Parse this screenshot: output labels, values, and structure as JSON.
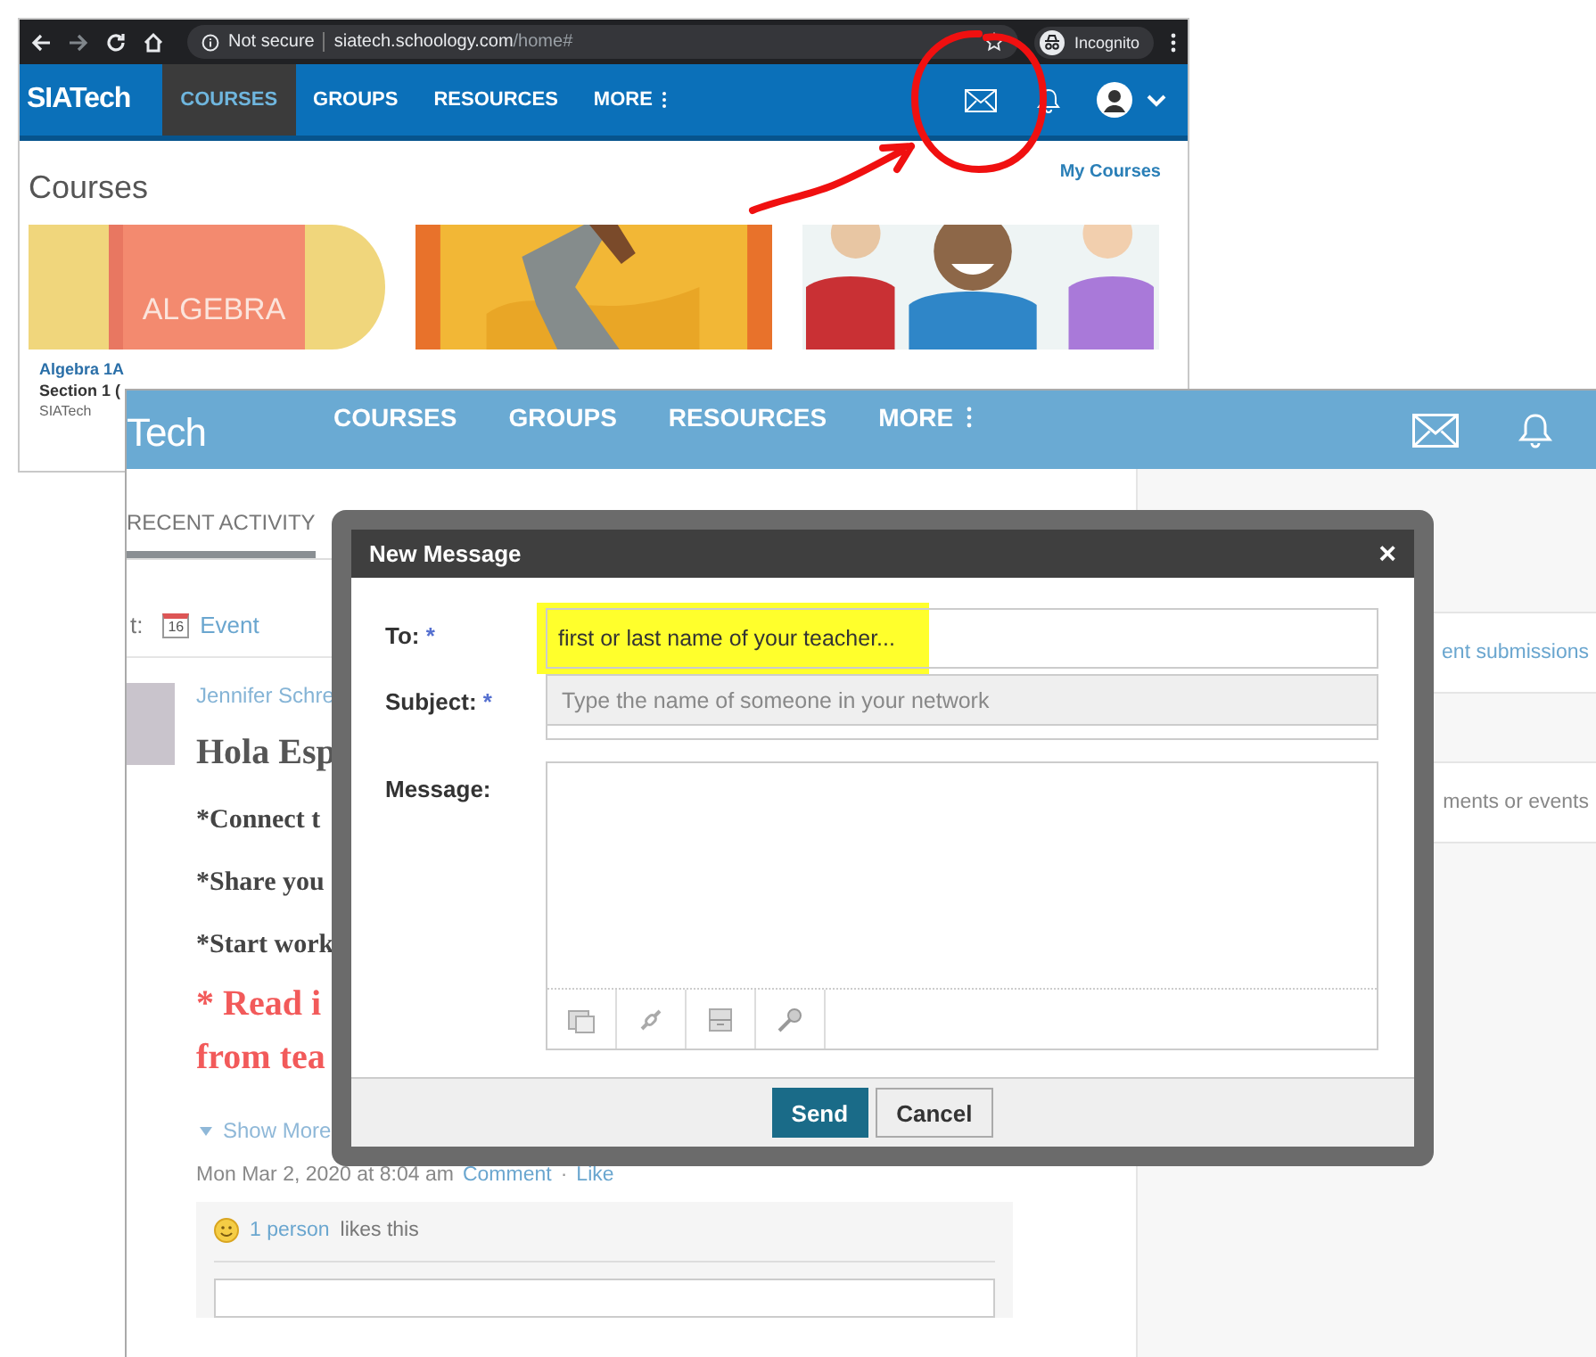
{
  "browser": {
    "security": "Not secure",
    "url_host": "siatech.schoology.com",
    "url_path": "/home#",
    "profile": "Incognito"
  },
  "home_screen": {
    "logo": "SIATech",
    "nav": [
      {
        "label": "COURSES",
        "selected": true,
        "has_menu": false
      },
      {
        "label": "GROUPS",
        "selected": false,
        "has_menu": false
      },
      {
        "label": "RESOURCES",
        "selected": false,
        "has_menu": false
      },
      {
        "label": "MORE",
        "selected": false,
        "has_menu": true
      }
    ],
    "title": "Courses",
    "link": "My Courses",
    "cards": [
      {
        "kind": "algebra",
        "cover_text": "ALGEBRA",
        "name": "Algebra 1A",
        "section": "Section 1 (",
        "school": "SIATech"
      },
      {
        "kind": "tools"
      },
      {
        "kind": "people"
      }
    ]
  },
  "course_screen": {
    "logo": "Tech",
    "nav": [
      {
        "label": "COURSES",
        "selected": false,
        "has_menu": false
      },
      {
        "label": "GROUPS",
        "selected": false,
        "has_menu": false
      },
      {
        "label": "RESOURCES",
        "selected": false,
        "has_menu": false
      },
      {
        "label": "MORE",
        "selected": false,
        "has_menu": true
      }
    ],
    "tabs": [
      {
        "label": "RECENT ACTIVITY",
        "selected": true
      }
    ],
    "post_prefix": "t:",
    "event_day": "16",
    "event_label": "Event",
    "post": {
      "author": "Jennifer Schre",
      "lines": [
        {
          "kind": "heading",
          "text": "Hola Esp"
        },
        {
          "kind": "bullet",
          "text": "*Connect t"
        },
        {
          "kind": "bullet",
          "text": "*Share you"
        },
        {
          "kind": "bullet",
          "text": "*Start work"
        },
        {
          "kind": "alert",
          "text": "* Read i"
        },
        {
          "kind": "alert",
          "text": "from tea"
        }
      ],
      "show_more": "Show More",
      "timestamp": "Mon Mar 2, 2020 at 8:04 am",
      "actions": [
        "Comment",
        "Like"
      ],
      "action_separator": "·",
      "likes_count": "1 person",
      "likes_text": "likes this"
    },
    "sidebar": [
      "ent submissions",
      "ments or events"
    ]
  },
  "dialog": {
    "title": "New Message",
    "close": "×",
    "required": "*",
    "to_label": "To:",
    "to_value": "first or last name of your teacher...",
    "to_highlighted": true,
    "suggestion": "Type the name of someone in your network",
    "subject_label": "Subject:",
    "message_label": "Message:",
    "buttons": [
      {
        "kind": "primary",
        "label": "Send"
      },
      {
        "kind": "secondary",
        "label": "Cancel"
      }
    ]
  }
}
